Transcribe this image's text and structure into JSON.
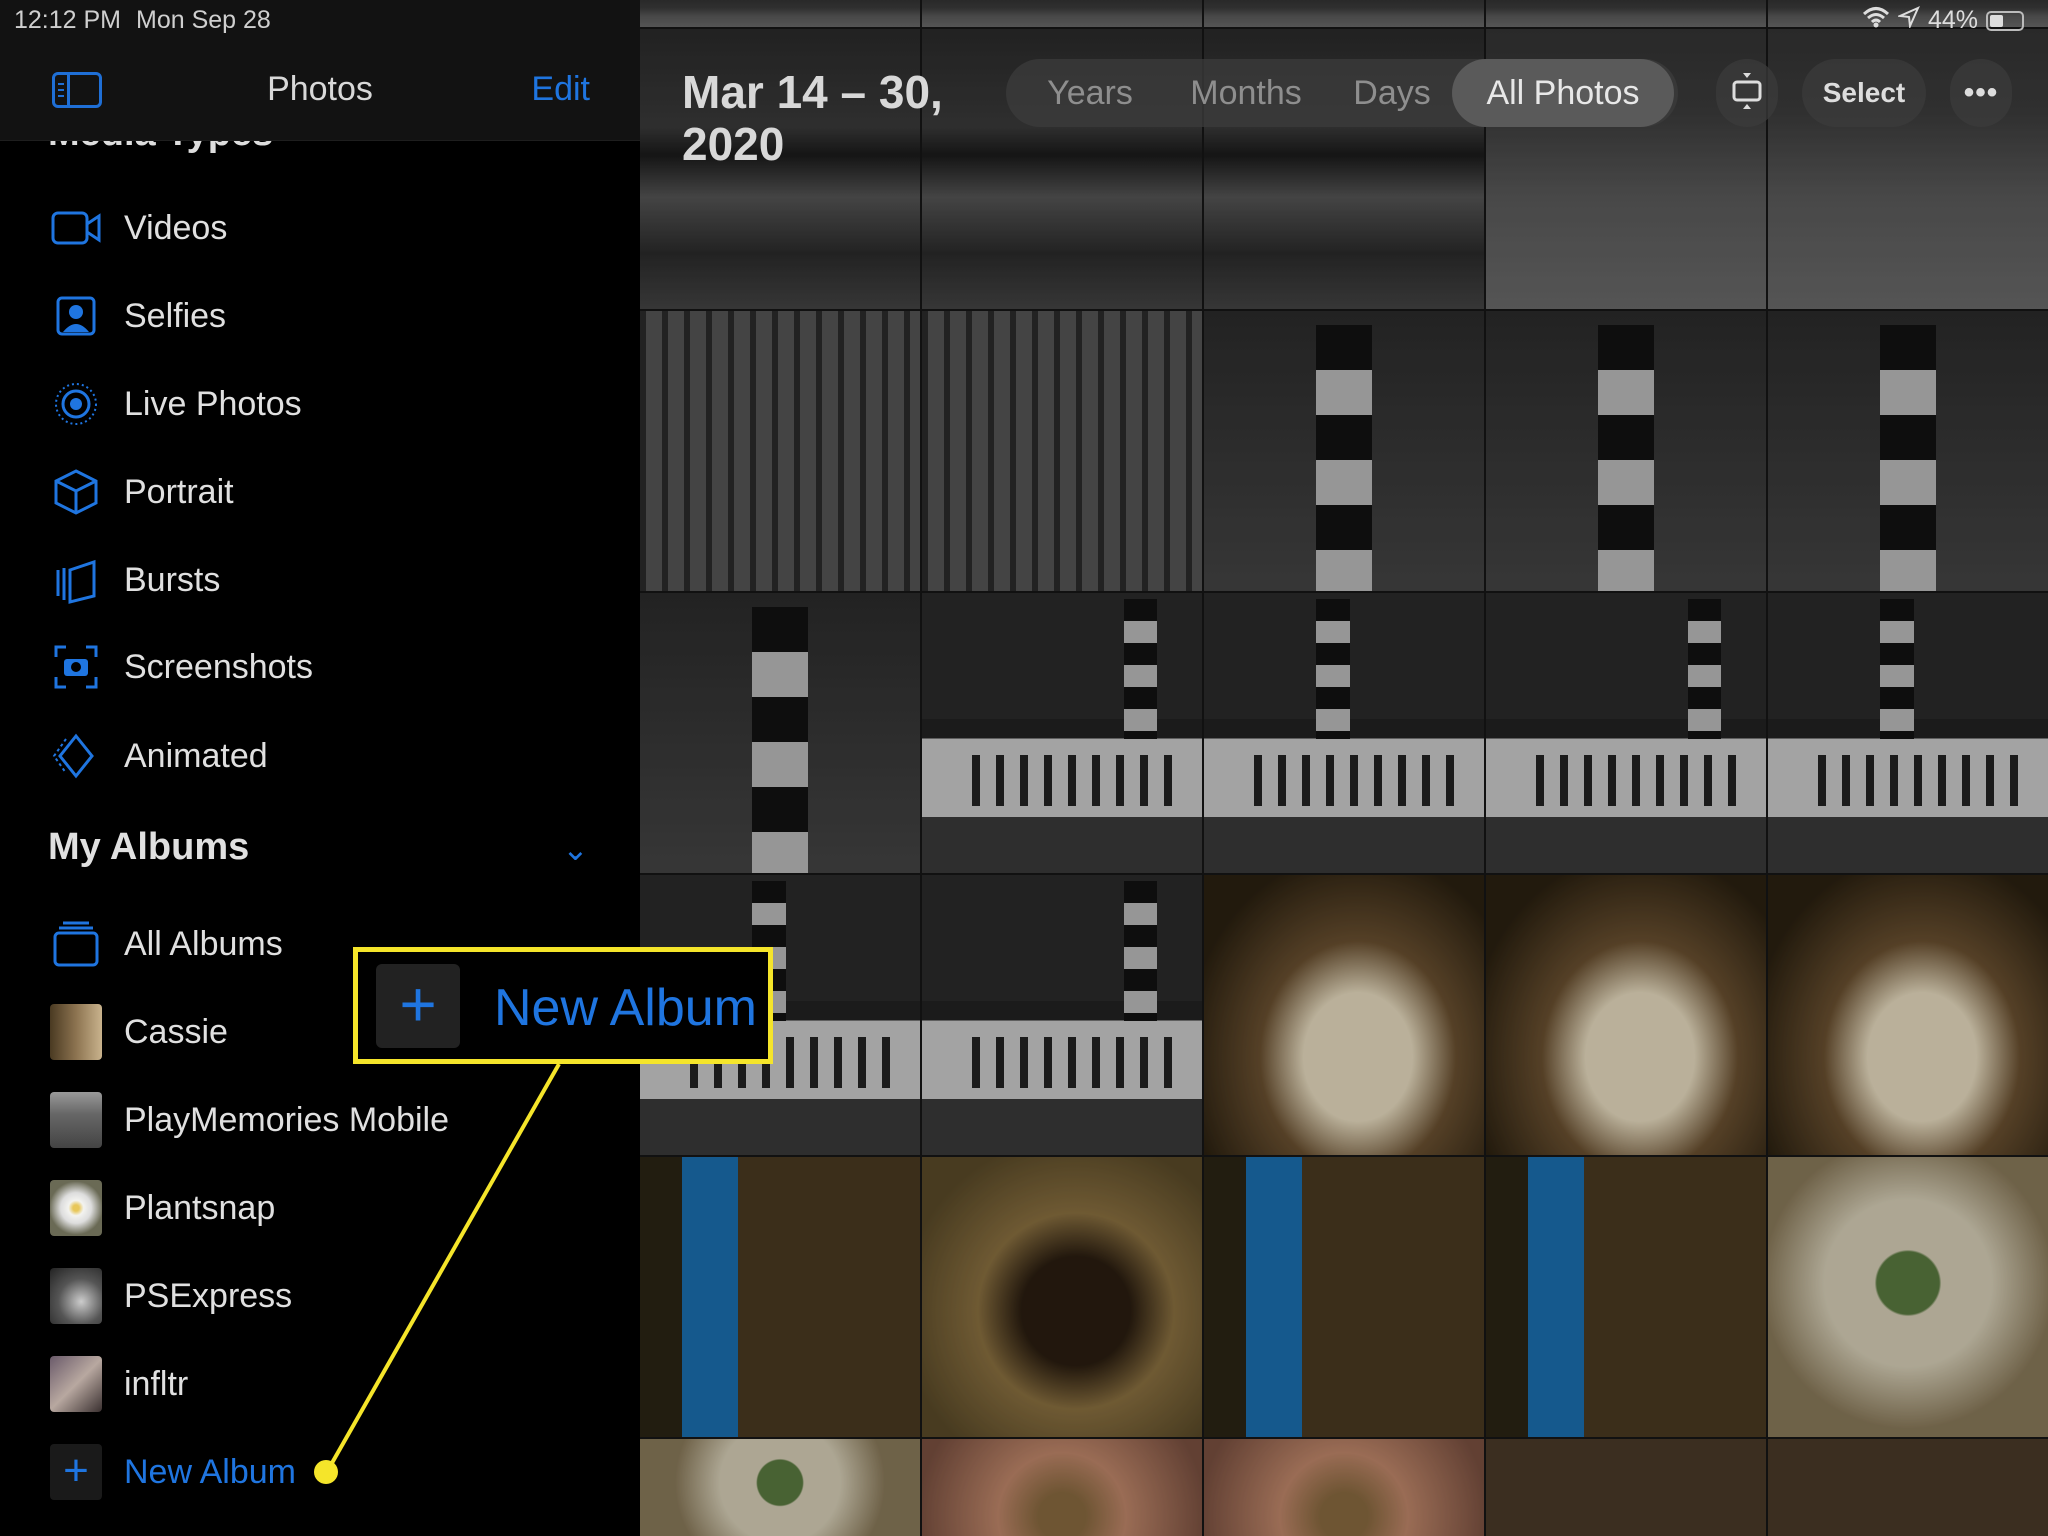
{
  "status_bar": {
    "time": "12:12 PM",
    "date": "Mon Sep 28",
    "battery": "44%",
    "battery_level": 0.44
  },
  "sidebar": {
    "title": "Photos",
    "edit_label": "Edit",
    "section_media": "Media Types",
    "media_items": [
      {
        "label": "Videos",
        "icon": "video-icon"
      },
      {
        "label": "Selfies",
        "icon": "selfie-icon"
      },
      {
        "label": "Live Photos",
        "icon": "live-photos-icon"
      },
      {
        "label": "Portrait",
        "icon": "cube-icon"
      },
      {
        "label": "Bursts",
        "icon": "bursts-icon"
      },
      {
        "label": "Screenshots",
        "icon": "screenshot-icon"
      },
      {
        "label": "Animated",
        "icon": "animated-icon"
      }
    ],
    "section_albums": "My Albums",
    "album_items": [
      {
        "label": "All Albums"
      },
      {
        "label": "Cassie"
      },
      {
        "label": "PlayMemories Mobile"
      },
      {
        "label": "Plantsnap"
      },
      {
        "label": "PSExpress"
      },
      {
        "label": "infltr"
      },
      {
        "label": "New Album"
      }
    ]
  },
  "main": {
    "date_range_line1": "Mar 14 – 30,",
    "date_range_line2": "2020",
    "tabs": [
      "Years",
      "Months",
      "Days",
      "All Photos"
    ],
    "active_tab": "All Photos",
    "select_label": "Select"
  },
  "callout": {
    "label": "New Album",
    "border_color": "#f5e52a"
  },
  "colors": {
    "accent": "#1f75e0",
    "highlight": "#f5e52a"
  }
}
